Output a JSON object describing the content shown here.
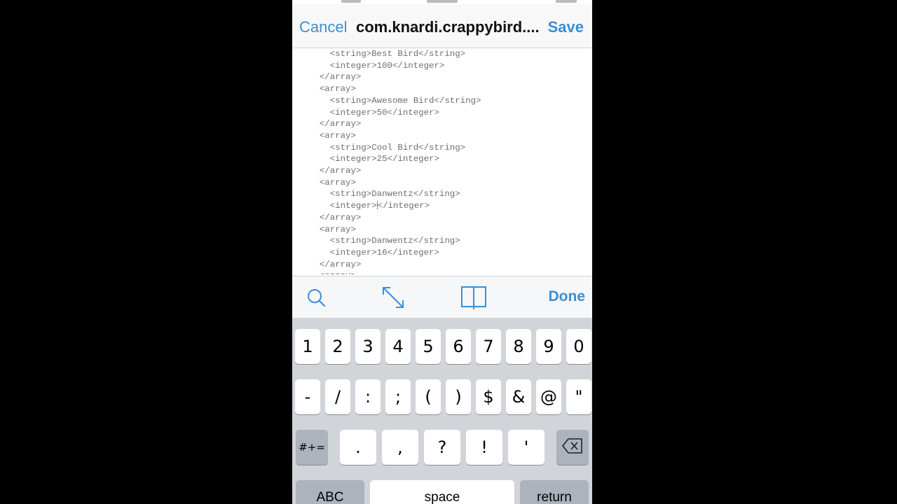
{
  "nav": {
    "cancel_label": "Cancel",
    "title": "com.knardi.crappybird....",
    "save_label": "Save"
  },
  "editor": {
    "lines": [
      "    <string>Best Bird</string>",
      "    <integer>100</integer>",
      "  </array>",
      "  <array>",
      "    <string>Awesome Bird</string>",
      "    <integer>50</integer>",
      "  </array>",
      "  <array>",
      "    <string>Cool Bird</string>",
      "    <integer>25</integer>",
      "  </array>",
      "  <array>",
      "    <string>Danwentz</string>",
      "    <integer></integer>",
      "  </array>",
      "  <array>",
      "    <string>Danwentz</string>",
      "    <integer>16</integer>",
      "  </array>"
    ],
    "caret_line": 13,
    "caret_after": "    <integer>"
  },
  "accessory": {
    "search_icon": "search-icon",
    "expand_icon": "expand-icon",
    "book_icon": "book-icon",
    "done_label": "Done"
  },
  "keyboard": {
    "row1": [
      "1",
      "2",
      "3",
      "4",
      "5",
      "6",
      "7",
      "8",
      "9",
      "0"
    ],
    "row2": [
      "-",
      "/",
      ":",
      ";",
      "(",
      ")",
      "$",
      "&",
      "@",
      "\""
    ],
    "row3": {
      "more_symbols": "#+=",
      "keys": [
        ".",
        ",",
        "?",
        "!",
        "'"
      ],
      "delete_icon": "backspace-icon"
    },
    "row4": {
      "abc": "ABC",
      "space": "space",
      "return": "return"
    }
  },
  "colors": {
    "accent": "#3a8fd6",
    "keyboard_bg": "#d1d4d9",
    "dark_key": "#acb3bc",
    "code_text": "#6e6e6e"
  }
}
